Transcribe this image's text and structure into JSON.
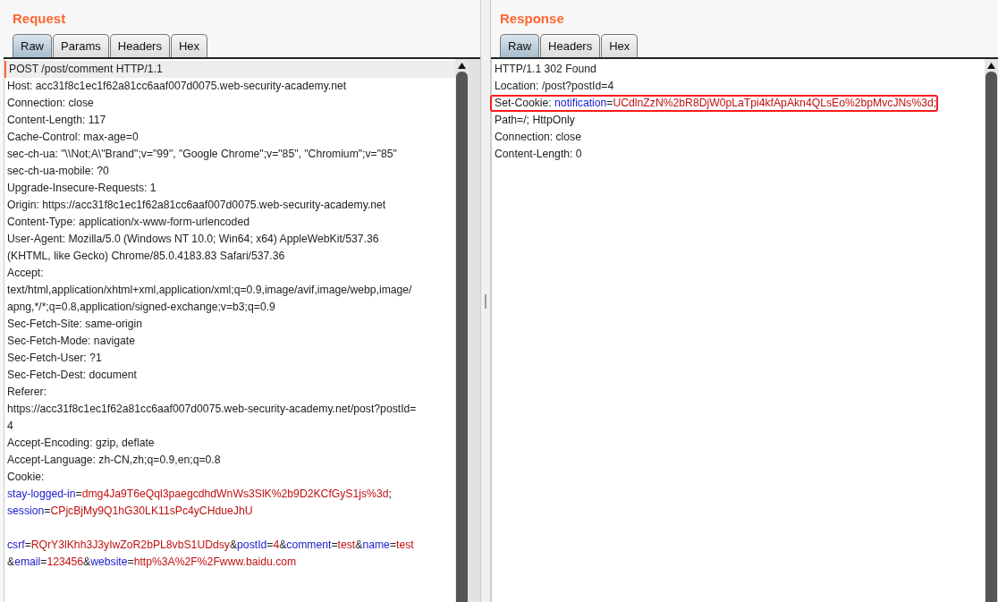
{
  "panels": [
    {
      "title": "Request",
      "tabs": [
        {
          "label": "Raw",
          "selected": true
        },
        {
          "label": "Params",
          "selected": false
        },
        {
          "label": "Headers",
          "selected": false
        },
        {
          "label": "Hex",
          "selected": false
        }
      ],
      "lines": [
        {
          "kind": "text",
          "current": true,
          "highlighted": false,
          "segments": [
            {
              "kind": "plain",
              "text": "POST /post/comment HTTP/1.1"
            }
          ]
        },
        {
          "kind": "text",
          "current": false,
          "highlighted": false,
          "segments": [
            {
              "kind": "plain",
              "text": "Host: acc31f8c1ec1f62a81cc6aaf007d0075.web-security-academy.net"
            }
          ]
        },
        {
          "kind": "text",
          "current": false,
          "highlighted": false,
          "segments": [
            {
              "kind": "plain",
              "text": "Connection: close"
            }
          ]
        },
        {
          "kind": "text",
          "current": false,
          "highlighted": false,
          "segments": [
            {
              "kind": "plain",
              "text": "Content-Length: 117"
            }
          ]
        },
        {
          "kind": "text",
          "current": false,
          "highlighted": false,
          "segments": [
            {
              "kind": "plain",
              "text": "Cache-Control: max-age=0"
            }
          ]
        },
        {
          "kind": "text",
          "current": false,
          "highlighted": false,
          "segments": [
            {
              "kind": "plain",
              "text": "sec-ch-ua: \"\\\\Not;A\\\"Brand\";v=\"99\", \"Google Chrome\";v=\"85\", \"Chromium\";v=\"85\""
            }
          ]
        },
        {
          "kind": "text",
          "current": false,
          "highlighted": false,
          "segments": [
            {
              "kind": "plain",
              "text": "sec-ch-ua-mobile: ?0"
            }
          ]
        },
        {
          "kind": "text",
          "current": false,
          "highlighted": false,
          "segments": [
            {
              "kind": "plain",
              "text": "Upgrade-Insecure-Requests: 1"
            }
          ]
        },
        {
          "kind": "text",
          "current": false,
          "highlighted": false,
          "segments": [
            {
              "kind": "plain",
              "text": "Origin: https://acc31f8c1ec1f62a81cc6aaf007d0075.web-security-academy.net"
            }
          ]
        },
        {
          "kind": "text",
          "current": false,
          "highlighted": false,
          "segments": [
            {
              "kind": "plain",
              "text": "Content-Type: application/x-www-form-urlencoded"
            }
          ]
        },
        {
          "kind": "text",
          "current": false,
          "highlighted": false,
          "segments": [
            {
              "kind": "plain",
              "text": "User-Agent: Mozilla/5.0 (Windows NT 10.0; Win64; x64) AppleWebKit/537.36"
            }
          ]
        },
        {
          "kind": "text",
          "current": false,
          "highlighted": false,
          "segments": [
            {
              "kind": "plain",
              "text": "(KHTML, like Gecko) Chrome/85.0.4183.83 Safari/537.36"
            }
          ]
        },
        {
          "kind": "text",
          "current": false,
          "highlighted": false,
          "segments": [
            {
              "kind": "plain",
              "text": "Accept:"
            }
          ]
        },
        {
          "kind": "text",
          "current": false,
          "highlighted": false,
          "segments": [
            {
              "kind": "plain",
              "text": "text/html,application/xhtml+xml,application/xml;q=0.9,image/avif,image/webp,image/"
            }
          ]
        },
        {
          "kind": "text",
          "current": false,
          "highlighted": false,
          "segments": [
            {
              "kind": "plain",
              "text": "apng,*/*;q=0.8,application/signed-exchange;v=b3;q=0.9"
            }
          ]
        },
        {
          "kind": "text",
          "current": false,
          "highlighted": false,
          "segments": [
            {
              "kind": "plain",
              "text": "Sec-Fetch-Site: same-origin"
            }
          ]
        },
        {
          "kind": "text",
          "current": false,
          "highlighted": false,
          "segments": [
            {
              "kind": "plain",
              "text": "Sec-Fetch-Mode: navigate"
            }
          ]
        },
        {
          "kind": "text",
          "current": false,
          "highlighted": false,
          "segments": [
            {
              "kind": "plain",
              "text": "Sec-Fetch-User: ?1"
            }
          ]
        },
        {
          "kind": "text",
          "current": false,
          "highlighted": false,
          "segments": [
            {
              "kind": "plain",
              "text": "Sec-Fetch-Dest: document"
            }
          ]
        },
        {
          "kind": "text",
          "current": false,
          "highlighted": false,
          "segments": [
            {
              "kind": "plain",
              "text": "Referer:"
            }
          ]
        },
        {
          "kind": "text",
          "current": false,
          "highlighted": false,
          "segments": [
            {
              "kind": "plain",
              "text": "https://acc31f8c1ec1f62a81cc6aaf007d0075.web-security-academy.net/post?postId="
            }
          ]
        },
        {
          "kind": "text",
          "current": false,
          "highlighted": false,
          "segments": [
            {
              "kind": "plain",
              "text": "4"
            }
          ]
        },
        {
          "kind": "text",
          "current": false,
          "highlighted": false,
          "segments": [
            {
              "kind": "plain",
              "text": "Accept-Encoding: gzip, deflate"
            }
          ]
        },
        {
          "kind": "text",
          "current": false,
          "highlighted": false,
          "segments": [
            {
              "kind": "plain",
              "text": "Accept-Language: zh-CN,zh;q=0.9,en;q=0.8"
            }
          ]
        },
        {
          "kind": "text",
          "current": false,
          "highlighted": false,
          "segments": [
            {
              "kind": "plain",
              "text": "Cookie:"
            }
          ]
        },
        {
          "kind": "text",
          "current": false,
          "highlighted": false,
          "segments": [
            {
              "kind": "key",
              "text": "stay-logged-in"
            },
            {
              "kind": "plain",
              "text": "="
            },
            {
              "kind": "value",
              "text": "dmg4Ja9T6eQql3paegcdhdWnWs3SlK%2b9D2KCfGyS1js%3d"
            },
            {
              "kind": "plain",
              "text": ";"
            }
          ]
        },
        {
          "kind": "text",
          "current": false,
          "highlighted": false,
          "segments": [
            {
              "kind": "key",
              "text": "session"
            },
            {
              "kind": "plain",
              "text": "="
            },
            {
              "kind": "value",
              "text": "CPjcBjMy9Q1hG30LK11sPc4yCHdueJhU"
            }
          ]
        },
        {
          "kind": "blank"
        },
        {
          "kind": "text",
          "current": false,
          "highlighted": false,
          "segments": [
            {
              "kind": "key",
              "text": "csrf"
            },
            {
              "kind": "plain",
              "text": "="
            },
            {
              "kind": "value",
              "text": "RQrY3lKhh3J3yIwZoR2bPL8vbS1UDdsy"
            },
            {
              "kind": "plain",
              "text": "&"
            },
            {
              "kind": "key",
              "text": "postId"
            },
            {
              "kind": "plain",
              "text": "="
            },
            {
              "kind": "value",
              "text": "4"
            },
            {
              "kind": "plain",
              "text": "&"
            },
            {
              "kind": "key",
              "text": "comment"
            },
            {
              "kind": "plain",
              "text": "="
            },
            {
              "kind": "value",
              "text": "test"
            },
            {
              "kind": "plain",
              "text": "&"
            },
            {
              "kind": "key",
              "text": "name"
            },
            {
              "kind": "plain",
              "text": "="
            },
            {
              "kind": "value",
              "text": "test"
            }
          ]
        },
        {
          "kind": "text",
          "current": false,
          "highlighted": false,
          "segments": [
            {
              "kind": "plain",
              "text": "&"
            },
            {
              "kind": "key",
              "text": "email"
            },
            {
              "kind": "plain",
              "text": "="
            },
            {
              "kind": "value",
              "text": "123456"
            },
            {
              "kind": "plain",
              "text": "&"
            },
            {
              "kind": "key",
              "text": "website"
            },
            {
              "kind": "plain",
              "text": "="
            },
            {
              "kind": "value",
              "text": "http%3A%2F%2Fwww.baidu.com"
            }
          ]
        }
      ]
    },
    {
      "title": "Response",
      "tabs": [
        {
          "label": "Raw",
          "selected": true
        },
        {
          "label": "Headers",
          "selected": false
        },
        {
          "label": "Hex",
          "selected": false
        }
      ],
      "lines": [
        {
          "kind": "text",
          "current": false,
          "highlighted": false,
          "segments": [
            {
              "kind": "plain",
              "text": "HTTP/1.1 302 Found"
            }
          ]
        },
        {
          "kind": "text",
          "current": false,
          "highlighted": false,
          "segments": [
            {
              "kind": "plain",
              "text": "Location: /post?postId=4"
            }
          ]
        },
        {
          "kind": "text",
          "current": false,
          "highlighted": true,
          "segments": [
            {
              "kind": "plain",
              "text": "Set-Cookie: "
            },
            {
              "kind": "key",
              "text": "notification"
            },
            {
              "kind": "plain",
              "text": "="
            },
            {
              "kind": "value",
              "text": "UCdlnZzN%2bR8DjW0pLaTpi4kfApAkn4QLsEo%2bpMvcJNs%3d"
            },
            {
              "kind": "plain",
              "text": ";"
            }
          ]
        },
        {
          "kind": "text",
          "current": false,
          "highlighted": false,
          "segments": [
            {
              "kind": "plain",
              "text": "Path=/; HttpOnly"
            }
          ]
        },
        {
          "kind": "text",
          "current": false,
          "highlighted": false,
          "segments": [
            {
              "kind": "plain",
              "text": "Connection: close"
            }
          ]
        },
        {
          "kind": "text",
          "current": false,
          "highlighted": false,
          "segments": [
            {
              "kind": "plain",
              "text": "Content-Length: 0"
            }
          ]
        }
      ]
    }
  ]
}
